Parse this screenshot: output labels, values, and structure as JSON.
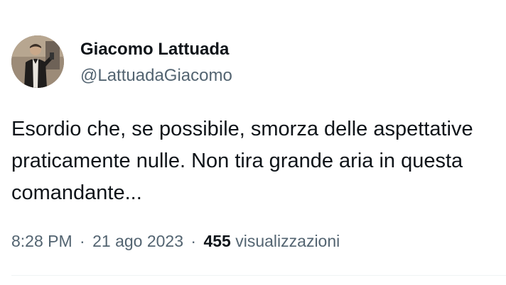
{
  "author": {
    "name": "Giacomo Lattuada",
    "handle": "@LattuadaGiacomo",
    "avatar_icon": "profile-photo"
  },
  "tweet": {
    "lines": [
      "Esordio che, se possibile, smorza delle aspettative",
      "praticamente nulle. Non tira grande aria in questa",
      "comandante..."
    ]
  },
  "meta": {
    "time": "8:28 PM",
    "date": "21 ago 2023",
    "separator": "·",
    "views_count": "455",
    "views_label": "visualizzazioni"
  },
  "colors": {
    "text": "#0f1419",
    "secondary": "#536471",
    "divider": "#eff3f4"
  }
}
